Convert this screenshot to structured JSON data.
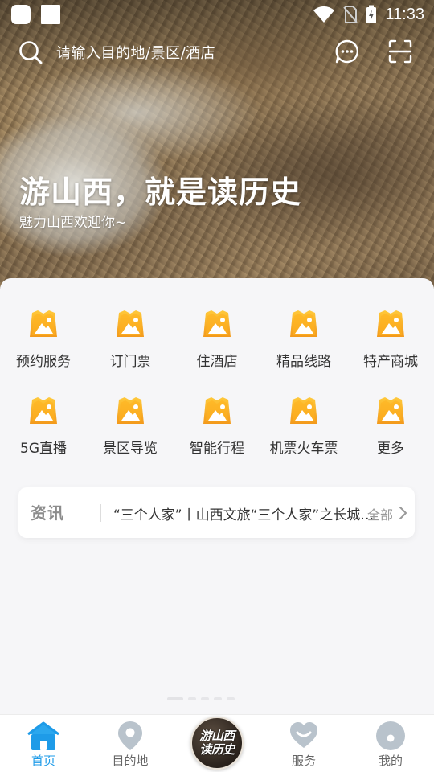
{
  "status_bar": {
    "time": "11:33",
    "icons": [
      "app-square-icon",
      "app-square-icon",
      "wifi-icon",
      "no-sim-icon",
      "battery-charging-icon"
    ]
  },
  "search": {
    "placeholder": "请输入目的地/景区/酒店",
    "icons": [
      "search-icon",
      "message-icon",
      "scan-icon"
    ]
  },
  "hero": {
    "title": "游山西，就是读历史",
    "subtitle": "魅力山西欢迎你~"
  },
  "services": [
    {
      "label": "预约服务",
      "icon": "service-image-icon"
    },
    {
      "label": "订门票",
      "icon": "service-image-icon"
    },
    {
      "label": "住酒店",
      "icon": "service-image-icon"
    },
    {
      "label": "精品线路",
      "icon": "service-image-icon"
    },
    {
      "label": "特产商城",
      "icon": "service-image-icon"
    },
    {
      "label": "5G直播",
      "icon": "service-image-icon"
    },
    {
      "label": "景区导览",
      "icon": "service-image-icon"
    },
    {
      "label": "智能行程",
      "icon": "service-image-icon"
    },
    {
      "label": "机票火车票",
      "icon": "service-image-icon"
    },
    {
      "label": "更多",
      "icon": "service-image-icon"
    }
  ],
  "news": {
    "brand": "资讯",
    "headline": "“三个人家”丨山西文旅“三个人家”之长城…",
    "all_label": "全部"
  },
  "bottom_nav": {
    "items": [
      {
        "label": "首页",
        "icon": "home-icon",
        "active": true
      },
      {
        "label": "目的地",
        "icon": "location-pin-icon",
        "active": false
      },
      {
        "label": "服务",
        "icon": "heart-icon",
        "active": false
      },
      {
        "label": "我的",
        "icon": "profile-icon",
        "active": false
      }
    ],
    "center_logo_line1": "游山西",
    "center_logo_line2": "读历史"
  },
  "colors": {
    "accent": "#1e9be8",
    "icon_orange": "#f5a623",
    "icon_inactive": "#b9c3cc"
  }
}
